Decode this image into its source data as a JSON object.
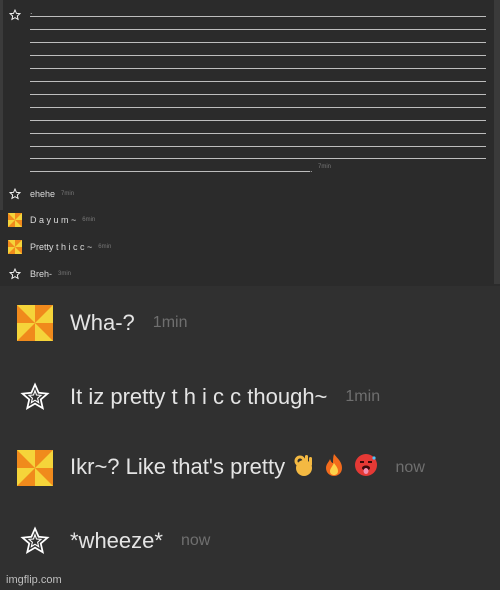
{
  "top_messages": {
    "long_message": {
      "lead_char": ".",
      "trail_char": ".",
      "timestamp": "7min"
    },
    "rows": [
      {
        "icon": "star-icon",
        "text": "ehehe",
        "timestamp": "7min"
      },
      {
        "icon": "pinwheel-icon",
        "text": "D a y u m ~",
        "timestamp": "6min"
      },
      {
        "icon": "pinwheel-icon",
        "text": "Pretty t h i c c ~",
        "timestamp": "6min"
      },
      {
        "icon": "star-icon",
        "text": "Breh-",
        "timestamp": "3min"
      }
    ]
  },
  "bottom_messages": [
    {
      "icon": "pinwheel-icon",
      "text": "Wha-?",
      "timestamp": "1min"
    },
    {
      "icon": "star-icon",
      "text": "It iz pretty t h i c c though~",
      "timestamp": "1min"
    },
    {
      "icon": "pinwheel-icon",
      "text": "Ikr~? Like that's pretty",
      "emojis": [
        "ok-hand-icon",
        "fire-icon",
        "hot-face-icon"
      ],
      "timestamp": "now"
    },
    {
      "icon": "star-icon",
      "text": "*wheeze*",
      "timestamp": "now"
    }
  ],
  "watermark": "imgflip.com",
  "colors": {
    "pinwheel_orange": "#f08a1c",
    "pinwheel_yellow": "#f5d43a",
    "star_outline": "#ffffff"
  }
}
